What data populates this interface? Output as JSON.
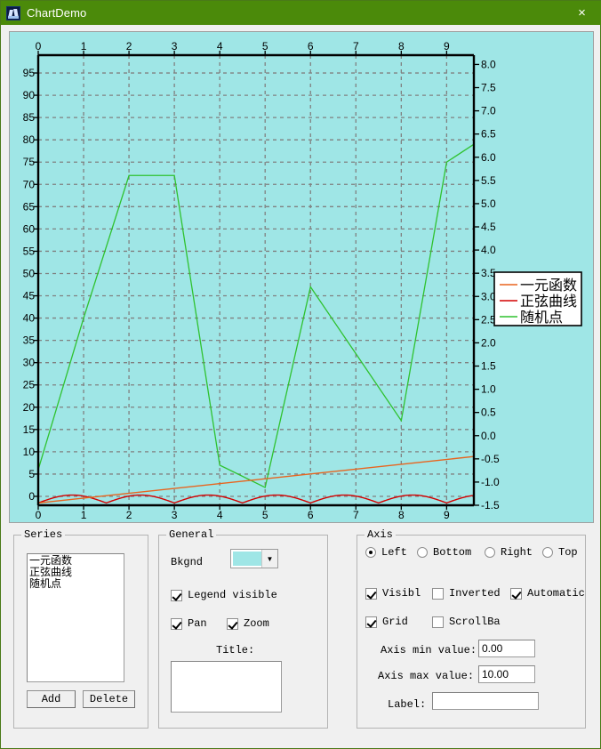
{
  "window": {
    "title": "ChartDemo",
    "icon": "app-icon",
    "close_label": "×",
    "titlebar_color": "#4b8a0a"
  },
  "chart": {
    "background_color": "#9fe6e6",
    "grid_color": "#808080",
    "axis_color": "#000000",
    "legend": {
      "visible": true,
      "entries": [
        {
          "label": "一元函数",
          "color": "#e8641e"
        },
        {
          "label": "正弦曲线",
          "color": "#d40000"
        },
        {
          "label": "随机点",
          "color": "#2fc22f"
        }
      ]
    }
  },
  "chart_data": {
    "type": "line",
    "title": "",
    "xlabel": "",
    "ylabel": "",
    "grid": true,
    "legend_position": "right",
    "axes": {
      "top": {
        "label": "",
        "ticks": [
          0,
          1,
          2,
          3,
          4,
          5,
          6,
          7,
          8,
          9
        ],
        "range": [
          0,
          9.6
        ]
      },
      "bottom": {
        "label": "",
        "ticks": [
          0,
          1,
          2,
          3,
          4,
          5,
          6,
          7,
          8,
          9
        ],
        "range": [
          0,
          9.6
        ]
      },
      "left": {
        "label": "",
        "range": [
          -2,
          99
        ],
        "ticks": [
          0,
          5,
          10,
          15,
          20,
          25,
          30,
          35,
          40,
          45,
          50,
          55,
          60,
          65,
          70,
          75,
          80,
          85,
          90,
          95
        ]
      },
      "right": {
        "label": "",
        "range": [
          -1.5,
          8.2
        ],
        "ticks": [
          -1.5,
          -1.0,
          -0.5,
          0.0,
          0.5,
          1.0,
          1.5,
          2.0,
          2.5,
          3.0,
          3.5,
          4.0,
          4.5,
          5.0,
          5.5,
          6.0,
          6.5,
          7.0,
          7.5,
          8.0
        ]
      }
    },
    "series": [
      {
        "name": "一元函数",
        "color": "#e8641e",
        "axis": "right",
        "x": [
          0,
          9.6
        ],
        "values": [
          -1.45,
          -0.45
        ]
      },
      {
        "name": "正弦曲线",
        "color": "#d40000",
        "axis": "right",
        "description": "sine wave, period 1.5 x-units, amplitude ~0.17, baseline -1.45",
        "x": [
          0,
          9.6
        ],
        "amplitude": 0.17,
        "period": 1.5,
        "baseline": -1.45
      },
      {
        "name": "随机点",
        "color": "#2fc22f",
        "axis": "left",
        "x": [
          0,
          1,
          2,
          3,
          4,
          5,
          6,
          7,
          8,
          9,
          9.6
        ],
        "values": [
          6,
          40,
          72,
          72,
          7,
          2,
          47,
          32,
          17,
          75,
          79
        ]
      }
    ]
  },
  "series_panel": {
    "title": "Series",
    "items": [
      "一元函数",
      "正弦曲线",
      "随机点"
    ],
    "add_label": "Add",
    "delete_label": "Delete"
  },
  "general_panel": {
    "title": "General",
    "bkgnd_label": "Bkgnd",
    "bkgnd_color": "#9fe6e6",
    "legend_visible": {
      "label": "Legend visible",
      "checked": true
    },
    "pan": {
      "label": "Pan",
      "checked": true
    },
    "zoom": {
      "label": "Zoom",
      "checked": true
    },
    "title_label": "Title:",
    "title_value": ""
  },
  "axis_panel": {
    "title": "Axis",
    "radios": [
      {
        "label": "Left",
        "selected": true
      },
      {
        "label": "Bottom",
        "selected": false
      },
      {
        "label": "Right",
        "selected": false
      },
      {
        "label": "Top",
        "selected": false
      }
    ],
    "visible": {
      "label": "Visibl",
      "checked": true
    },
    "inverted": {
      "label": "Inverted",
      "checked": false
    },
    "automatic": {
      "label": "Automatic",
      "checked": true
    },
    "grid": {
      "label": "Grid",
      "checked": true
    },
    "scrollbar": {
      "label": "ScrollBa",
      "checked": false
    },
    "min_label": "Axis min value:",
    "min_value": "0.00",
    "max_label": "Axis max value:",
    "max_value": "10.00",
    "label_label": "Label:",
    "label_value": ""
  }
}
